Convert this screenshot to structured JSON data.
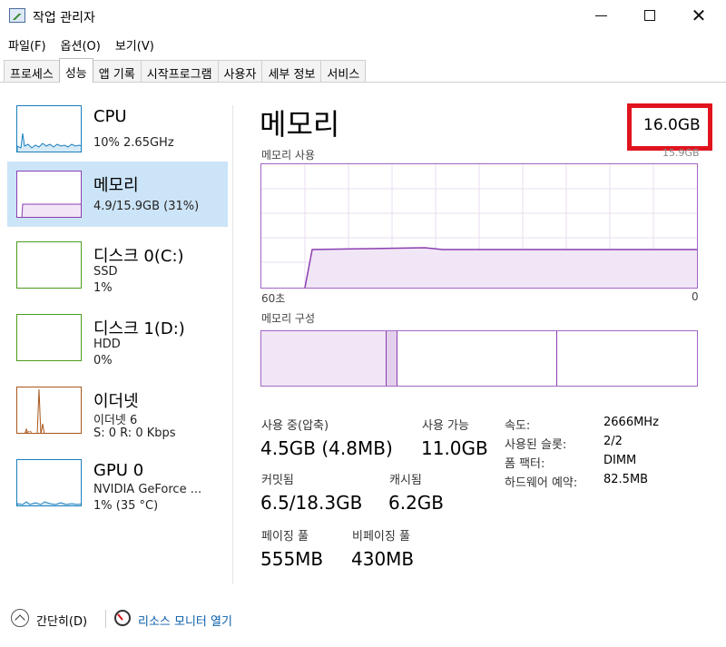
{
  "window": {
    "title": "작업 관리자"
  },
  "menu": [
    "파일(F)",
    "옵션(O)",
    "보기(V)"
  ],
  "tabs": [
    "프로세스",
    "성능",
    "앱 기록",
    "시작프로그램",
    "사용자",
    "세부 정보",
    "서비스"
  ],
  "active_tab": "성능",
  "sidebar": {
    "items": [
      {
        "title": "CPU",
        "line1": "10% 2.65GHz",
        "line2": "",
        "color": "#1a7fbe"
      },
      {
        "title": "메모리",
        "line1": "4.9/15.9GB (31%)",
        "line2": "",
        "color": "#8b3fb0"
      },
      {
        "title": "디스크 0(C:)",
        "line1": "SSD",
        "line2": "1%",
        "color": "#4c9c1c"
      },
      {
        "title": "디스크 1(D:)",
        "line1": "HDD",
        "line2": "0%",
        "color": "#4c9c1c"
      },
      {
        "title": "이더넷",
        "line1": "이더넷 6",
        "line2": "S: 0 R: 0 Kbps",
        "color": "#a8581c"
      },
      {
        "title": "GPU 0",
        "line1": "NVIDIA GeForce ...",
        "line2": "1% (35 °C)",
        "color": "#1a7fbe"
      }
    ]
  },
  "main": {
    "title": "메모리",
    "total": "16.0GB",
    "usage_label": "메모리 사용",
    "usage_max": "15.9GB",
    "time_left": "60초",
    "time_right": "0",
    "composition_label": "메모리 구성",
    "usage_fraction": 0.31
  },
  "stats": {
    "in_use_label": "사용 중(압축)",
    "in_use_value": "4.5GB (4.8MB)",
    "available_label": "사용 가능",
    "available_value": "11.0GB",
    "committed_label": "커밋됨",
    "committed_value": "6.5/18.3GB",
    "cached_label": "캐시됨",
    "cached_value": "6.2GB",
    "paged_label": "페이징 풀",
    "paged_value": "555MB",
    "nonpaged_label": "비페이징 풀",
    "nonpaged_value": "430MB"
  },
  "details": [
    {
      "label": "속도:",
      "value": "2666MHz"
    },
    {
      "label": "사용된 슬롯:",
      "value": "2/2"
    },
    {
      "label": "폼 팩터:",
      "value": "DIMM"
    },
    {
      "label": "하드웨어 예약:",
      "value": "82.5MB"
    }
  ],
  "footer": {
    "fewer_details": "간단히(D)",
    "resource_monitor": "리소스 모니터 열기"
  }
}
